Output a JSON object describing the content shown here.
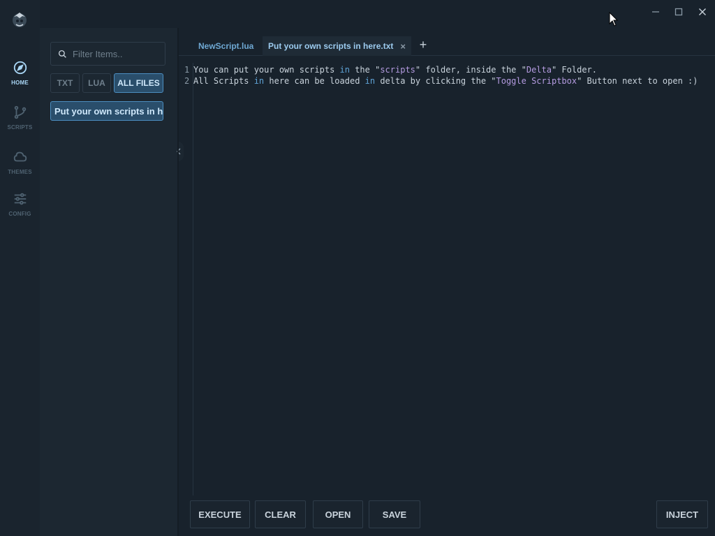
{
  "nav": {
    "items": [
      {
        "label": "HOME",
        "icon": "compass-icon",
        "active": true
      },
      {
        "label": "SCRIPTS",
        "icon": "git-branch-icon",
        "active": false
      },
      {
        "label": "THEMES",
        "icon": "cloud-icon",
        "active": false
      },
      {
        "label": "CONFIG",
        "icon": "sliders-icon",
        "active": false
      }
    ]
  },
  "file_panel": {
    "filter_placeholder": "Filter Items..",
    "file_types": [
      "TXT",
      "LUA",
      "ALL FILES"
    ],
    "active_type": "ALL FILES",
    "files": [
      "Put your own scripts in here.txt"
    ]
  },
  "tabs": [
    {
      "label": "NewScript.lua",
      "active": false
    },
    {
      "label": "Put your own scripts in here.txt",
      "active": true
    }
  ],
  "tab_close_label": "×",
  "add_tab_label": "+",
  "editor": {
    "lines": [
      {
        "num": "1",
        "text": "You can put your own scripts in the \"scripts\" folder, inside the \"Delta\" Folder."
      },
      {
        "num": "2",
        "text": "All Scripts in here can be loaded in delta by clicking the \"Toggle Scriptbox\" Button next to open :)"
      }
    ]
  },
  "buttons": {
    "execute": "EXECUTE",
    "clear": "CLEAR",
    "open": "OPEN",
    "save": "SAVE",
    "inject": "INJECT"
  },
  "colors": {
    "background": "#18222c",
    "accent": "#4c8ec1",
    "active_label": "#a9d6f5",
    "keyword": "#5fa3d6",
    "string": "#b49be0"
  }
}
